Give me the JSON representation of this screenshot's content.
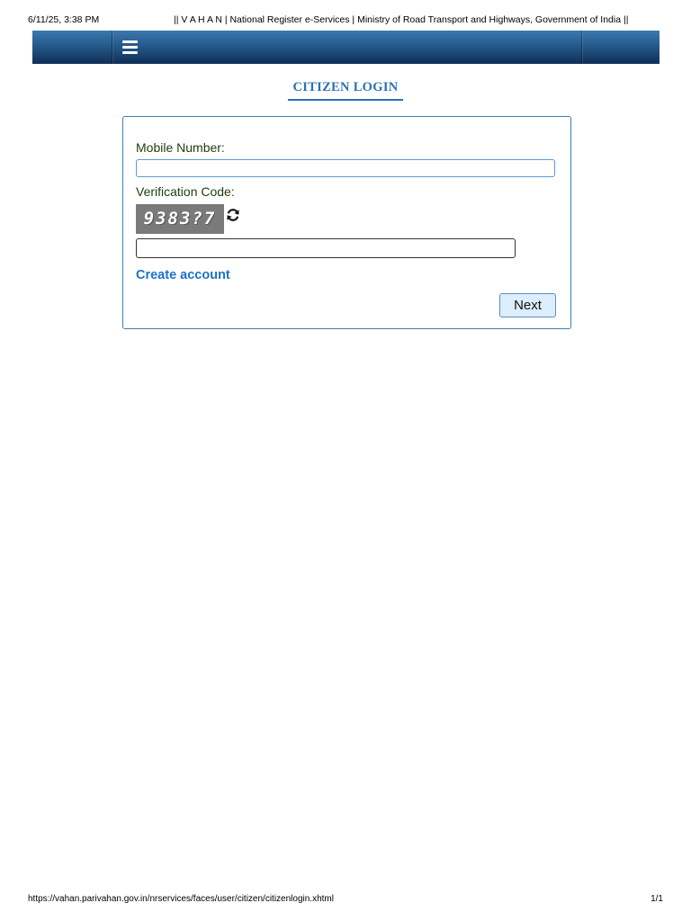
{
  "print_header": {
    "date": "6/11/25, 3:38 PM",
    "title": "|| V A H A N | National Register e-Services | Ministry of Road Transport and Highways, Government of India ||"
  },
  "navbar": {
    "menu_icon": "hamburger-menu-icon"
  },
  "page": {
    "title": "CITIZEN LOGIN"
  },
  "login_form": {
    "mobile_label": "Mobile Number:",
    "mobile_value": "",
    "verification_label": "Verification Code:",
    "captcha_text": "9383?7",
    "refresh_icon": "refresh-icon",
    "captcha_value": "",
    "create_account_label": "Create account",
    "next_label": "Next"
  },
  "print_footer": {
    "url": "https://vahan.parivahan.gov.in/nrservices/faces/user/citizen/citizenlogin.xhtml",
    "page": "1/1"
  },
  "colors": {
    "nav_top": "#3b78ae",
    "nav_bottom": "#0e2f56",
    "title_blue": "#2a6fb3",
    "link_blue": "#1a73c9",
    "label_green": "#1f3d0c",
    "button_bg": "#dcedfb"
  }
}
